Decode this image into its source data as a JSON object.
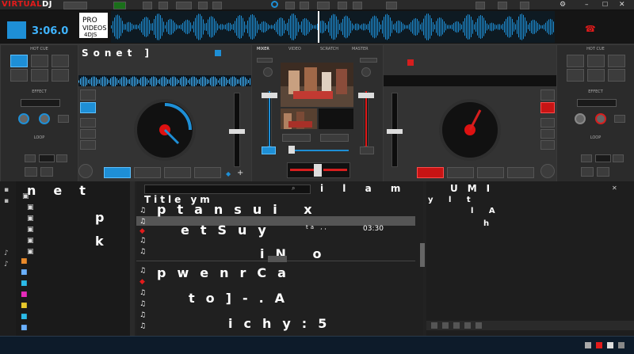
{
  "app": {
    "logo_prefix": "VIRTUAL",
    "logo_suffix": "DJ"
  },
  "deck_left": {
    "time": "3:06.0",
    "track_label": "Sonet ]",
    "hot_cue_label": "HOT CUE",
    "effect_label": "EFFECT",
    "loop_label": "LOOP",
    "color": "#1e8fd6"
  },
  "deck_right": {
    "hot_cue_label": "HOT CUE",
    "effect_label": "EFFECT",
    "loop_label": "LOOP",
    "color": "#d61e1e"
  },
  "mixer": {
    "tabs": [
      "MIXER",
      "VIDEO",
      "SCRATCH",
      "MASTER"
    ]
  },
  "browser": {
    "folders_header": "net",
    "folder_items": [
      "p",
      "k"
    ],
    "list_header": "Title",
    "list_rows": [
      {
        "text": "Title ym"
      },
      {
        "text": "ptansui x"
      },
      {
        "text": "etSuy",
        "sub": "ta ,,",
        "time": "03:30"
      },
      {
        "text": "iN o"
      },
      {
        "text": "pwenrCa"
      },
      {
        "text": "to]-.A"
      },
      {
        "text": "ichy:5"
      }
    ],
    "side_header": "UMI",
    "side_items": [
      "y l t",
      "l A",
      "h"
    ]
  },
  "taskbar": {
    "clock": "",
    "icons": [
      "tray-icon-1",
      "tray-icon-2",
      "tray-icon-3",
      "tray-icon-4"
    ]
  }
}
